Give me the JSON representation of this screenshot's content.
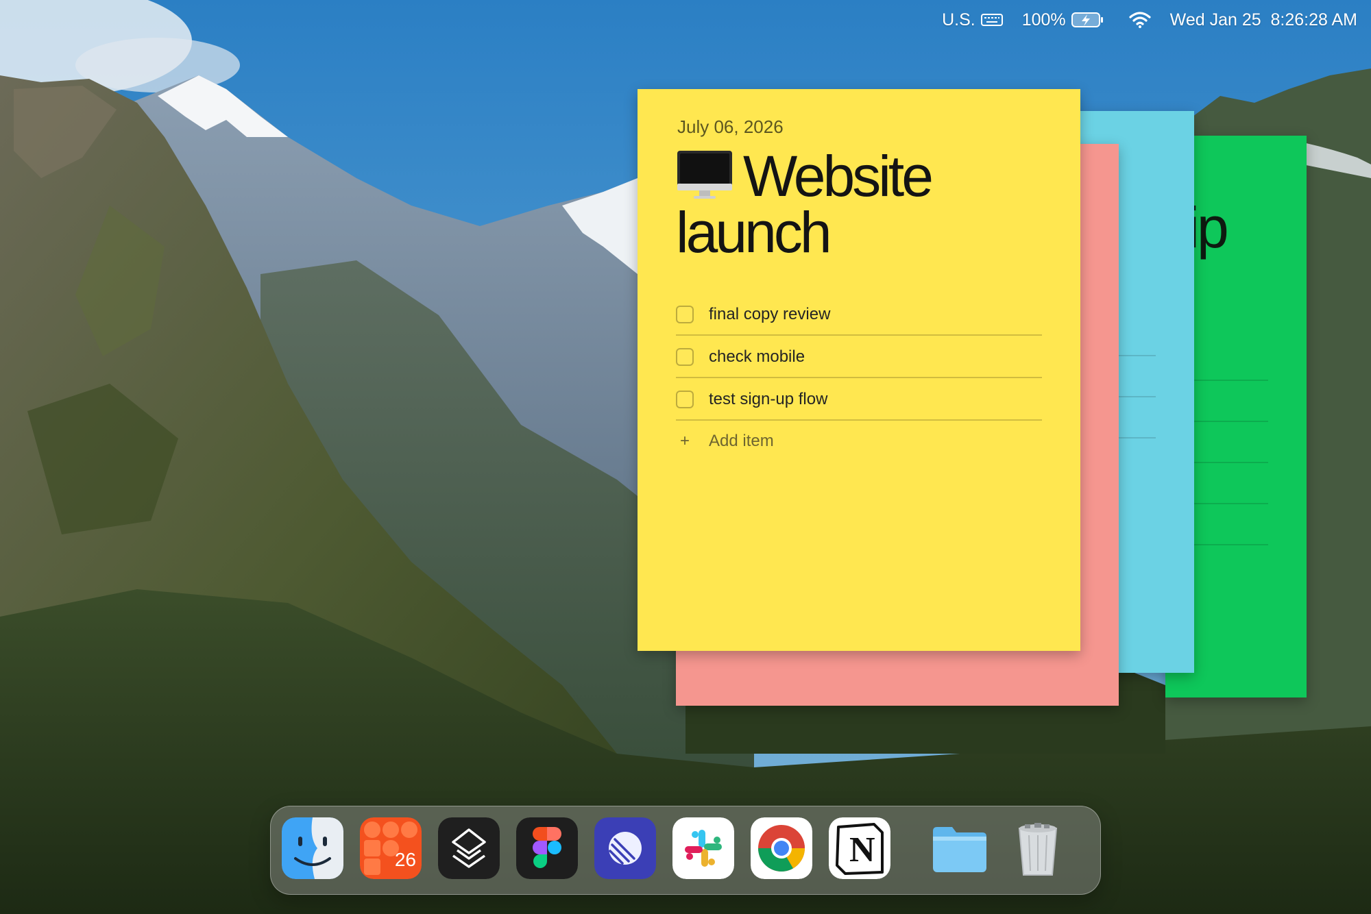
{
  "menubar": {
    "input_source": "U.S.",
    "battery_percent": "100%",
    "datetime": "Wed Jan 25  8:26:28 AM",
    "icons": [
      "keyboard-icon",
      "battery-charging-icon",
      "wifi-icon"
    ]
  },
  "notes": {
    "active": {
      "color": "#ffe750",
      "date": "July 06, 2026",
      "emoji": "desktop-computer-icon",
      "title_line1": "Website",
      "title_line2": "launch",
      "items": [
        {
          "label": "final copy review",
          "checked": false
        },
        {
          "label": "check mobile",
          "checked": false
        },
        {
          "label": "test sign-up flow",
          "checked": false
        }
      ],
      "add_item_label": "Add item"
    },
    "background": [
      {
        "color": "#f5968f"
      },
      {
        "color": "#6bd2e4"
      },
      {
        "color": "#0ec75a",
        "visible_title_fragment": "trip"
      }
    ]
  },
  "dock": {
    "apps": [
      {
        "name": "Finder",
        "icon": "finder-icon"
      },
      {
        "name": "Calendar",
        "icon": "calendar-app-icon",
        "badge_text": "26"
      },
      {
        "name": "Layers",
        "icon": "layers-app-icon"
      },
      {
        "name": "Figma",
        "icon": "figma-icon"
      },
      {
        "name": "Linear",
        "icon": "linear-icon"
      },
      {
        "name": "Slack",
        "icon": "slack-icon"
      },
      {
        "name": "Chrome",
        "icon": "chrome-icon"
      },
      {
        "name": "Notion",
        "icon": "notion-icon",
        "glyph": "N"
      },
      {
        "name": "Folder",
        "icon": "folder-icon"
      },
      {
        "name": "Trash",
        "icon": "trash-icon"
      }
    ]
  }
}
